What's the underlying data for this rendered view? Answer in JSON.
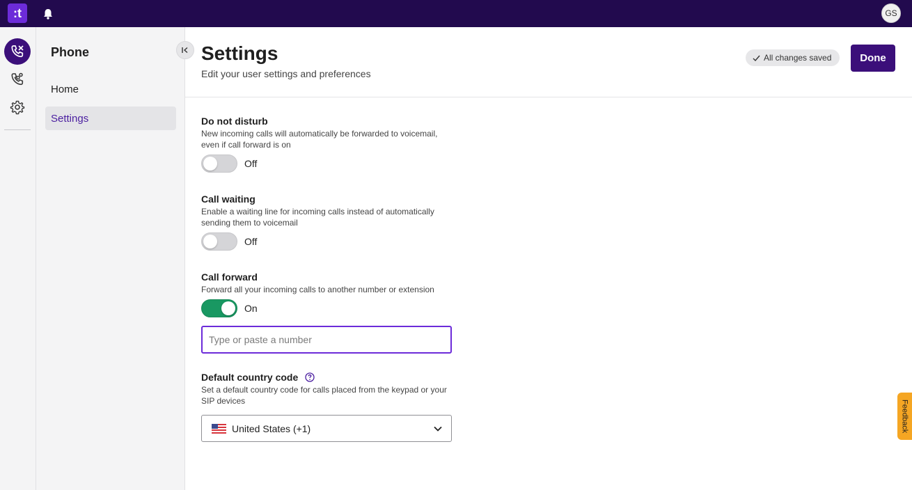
{
  "topbar": {
    "logo_text": ":t",
    "avatar_initials": "GS"
  },
  "rail": {
    "icons": [
      "phone-calls-icon",
      "call-routing-icon",
      "gear-icon"
    ]
  },
  "nav": {
    "title": "Phone",
    "items": [
      {
        "label": "Home",
        "active": false
      },
      {
        "label": "Settings",
        "active": true
      }
    ]
  },
  "header": {
    "title": "Settings",
    "subtitle": "Edit your user settings and preferences",
    "saved_status": "All changes saved",
    "done_label": "Done"
  },
  "settings": {
    "dnd": {
      "title": "Do not disturb",
      "desc_line1": "New incoming calls will automatically be forwarded to voicemail,",
      "desc_line2": "even if call forward is on",
      "state": "Off"
    },
    "call_waiting": {
      "title": "Call waiting",
      "desc_line1": "Enable a waiting line for incoming calls instead of automatically",
      "desc_line2": "sending them to voicemail",
      "state": "Off"
    },
    "call_forward": {
      "title": "Call forward",
      "desc_line1": "Forward all your incoming calls to another number or extension",
      "state": "On",
      "input_value": "",
      "input_placeholder": "Type or paste a number"
    },
    "country_code": {
      "title": "Default country code",
      "desc_line1": "Set a default country code for calls placed from the keypad or your",
      "desc_line2": "SIP devices",
      "selected": "United States (+1)"
    }
  },
  "feedback_label": "Feedback",
  "colors": {
    "topbar": "#220a4e",
    "accent": "#3b0f7a",
    "toggle_on": "#199862",
    "focus": "#6c2bd9",
    "feedback": "#f5a623"
  }
}
